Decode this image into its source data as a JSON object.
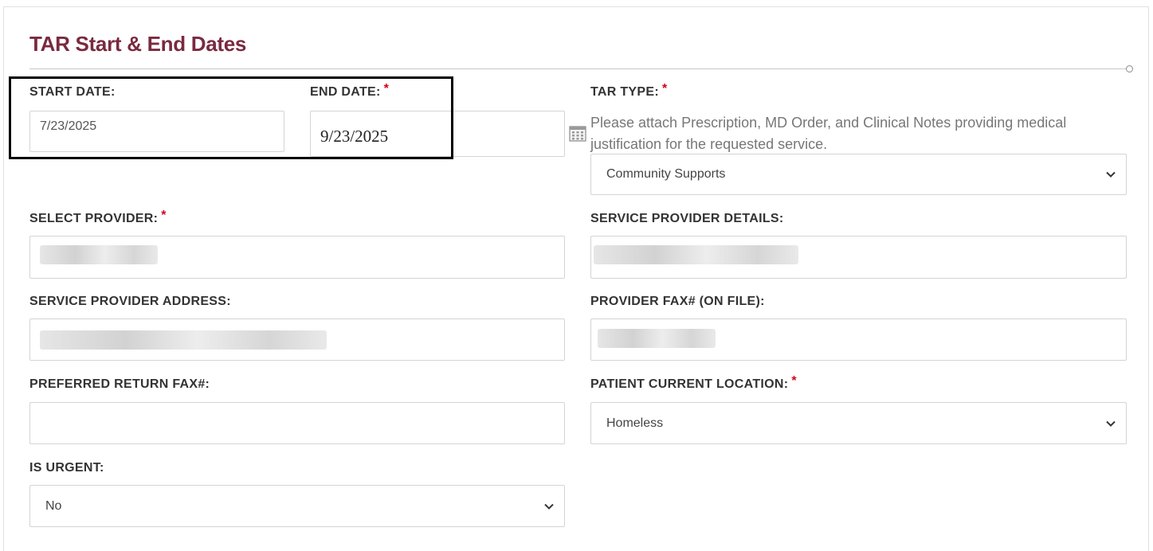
{
  "section": {
    "title": "TAR Start & End Dates"
  },
  "fields": {
    "start_date": {
      "label": "START DATE:",
      "value": "7/23/2025"
    },
    "end_date": {
      "label": "END DATE:",
      "required_mark": "*",
      "value": "9/23/2025"
    },
    "tar_type": {
      "label": "TAR TYPE:",
      "required_mark": "*",
      "hint": "Please attach Prescription, MD Order, and Clinical Notes providing medical justification for the requested service.",
      "value": "Community Supports"
    },
    "select_provider": {
      "label": "SELECT PROVIDER:",
      "required_mark": "*"
    },
    "service_provider_details": {
      "label": "SERVICE PROVIDER DETAILS:"
    },
    "service_provider_address": {
      "label": "SERVICE PROVIDER ADDRESS:"
    },
    "provider_fax": {
      "label": "PROVIDER FAX# (ON FILE):"
    },
    "preferred_return_fax": {
      "label": "PREFERRED RETURN FAX#:",
      "value": ""
    },
    "patient_current_location": {
      "label": "PATIENT CURRENT LOCATION:",
      "required_mark": "*",
      "value": "Homeless"
    },
    "is_urgent": {
      "label": "IS URGENT:",
      "value": "No"
    }
  },
  "icons": {
    "calendar": "calendar-icon",
    "dropdown": "chevron-down-icon"
  },
  "colors": {
    "title": "#7a2a3f",
    "required": "#d0021b",
    "border": "#d4d4d4"
  }
}
